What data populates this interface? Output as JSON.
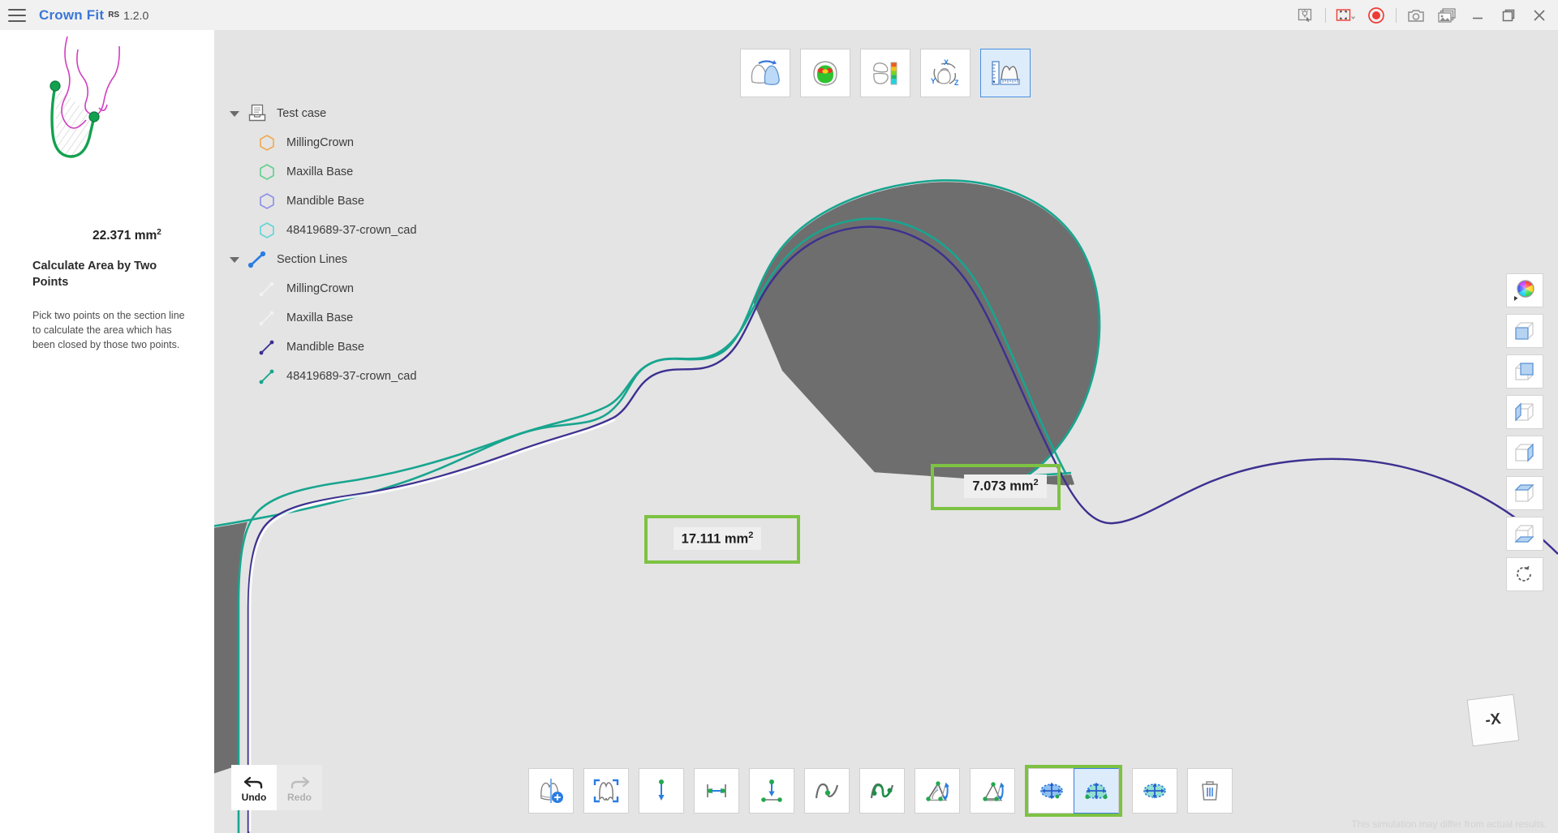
{
  "window": {
    "app_name": "Crown Fit",
    "app_mark": "RS",
    "version": "1.2.0",
    "menu_icon": "hamburger-menu-icon",
    "controls": [
      {
        "name": "annotation-pointer-icon",
        "label": "Annotate"
      },
      {
        "name": "region-capture-icon",
        "label": "Capture Region"
      },
      {
        "name": "record-icon",
        "label": "Record"
      },
      {
        "name": "camera-icon",
        "label": "Screenshot"
      },
      {
        "name": "gallery-icon",
        "label": "Gallery"
      },
      {
        "name": "minimize-icon",
        "label": "Minimize"
      },
      {
        "name": "maximize-icon",
        "label": "Maximize"
      },
      {
        "name": "close-icon",
        "label": "Close"
      }
    ]
  },
  "sidebar": {
    "preview_area_value": "22.371 mm",
    "preview_area_unit": "2",
    "heading": "Calculate Area by Two Points",
    "description": "Pick two points on the section line to calculate the area which has been closed by those two points."
  },
  "tree": {
    "groups": [
      {
        "label": "Test case",
        "icon": "case-tray-icon",
        "expanded": true,
        "items": [
          {
            "label": "MillingCrown",
            "icon": "hexagon-outline-icon",
            "color": "#f0a94e"
          },
          {
            "label": "Maxilla Base",
            "icon": "hexagon-outline-icon",
            "color": "#5fd08a"
          },
          {
            "label": "Mandible Base",
            "icon": "hexagon-outline-icon",
            "color": "#8d8ee8"
          },
          {
            "label": "48419689-37-crown_cad",
            "icon": "hexagon-outline-icon",
            "color": "#5fd6d6"
          }
        ]
      },
      {
        "label": "Section Lines",
        "icon": "section-line-icon",
        "expanded": true,
        "items": [
          {
            "label": "MillingCrown",
            "icon": "line-segment-icon",
            "color": "#ffffff"
          },
          {
            "label": "Maxilla Base",
            "icon": "line-segment-icon",
            "color": "#fafafa"
          },
          {
            "label": "Mandible Base",
            "icon": "line-segment-icon",
            "color": "#3c3090"
          },
          {
            "label": "48419689-37-crown_cad",
            "icon": "line-segment-icon",
            "color": "#18a58f"
          }
        ]
      }
    ]
  },
  "top_toolbar": {
    "buttons": [
      {
        "name": "crown-placement-icon",
        "label": "Crown Placement",
        "active": false
      },
      {
        "name": "contact-map-icon",
        "label": "Contact Map",
        "active": false
      },
      {
        "name": "thickness-colormap-icon",
        "label": "Thickness Color Map",
        "active": false
      },
      {
        "name": "orientation-axes-icon",
        "label": "Orientation",
        "active": false
      },
      {
        "name": "measure-ruler-icon",
        "label": "Measurement",
        "active": true
      }
    ]
  },
  "right_toolbar": {
    "buttons": [
      {
        "name": "color-wheel-icon",
        "label": "Color"
      },
      {
        "name": "view-front-icon",
        "label": "Front View"
      },
      {
        "name": "view-back-icon",
        "label": "Back View"
      },
      {
        "name": "view-left-icon",
        "label": "Left View"
      },
      {
        "name": "view-right-icon",
        "label": "Right View"
      },
      {
        "name": "view-top-icon",
        "label": "Top View"
      },
      {
        "name": "view-bottom-icon",
        "label": "Bottom View"
      },
      {
        "name": "reset-view-icon",
        "label": "Reset View"
      }
    ]
  },
  "bottom_toolbar": {
    "buttons": [
      {
        "name": "add-section-plane-icon",
        "label": "Add Section Plane",
        "state": "normal"
      },
      {
        "name": "fit-section-icon",
        "label": "Fit Section",
        "state": "normal"
      },
      {
        "name": "vertical-distance-icon",
        "label": "Vertical Distance",
        "state": "normal"
      },
      {
        "name": "horizontal-distance-icon",
        "label": "Horizontal Distance",
        "state": "normal"
      },
      {
        "name": "point-to-line-distance-icon",
        "label": "Point to Line Distance",
        "state": "normal"
      },
      {
        "name": "curve-point-icon",
        "label": "Point on Curve",
        "state": "normal"
      },
      {
        "name": "curve-segment-icon",
        "label": "Curve Segment",
        "state": "normal"
      },
      {
        "name": "angle-icon",
        "label": "Angle",
        "state": "normal"
      },
      {
        "name": "three-point-angle-icon",
        "label": "Three Point Angle",
        "state": "normal"
      },
      {
        "name": "area-closed-icon",
        "label": "Area of Closed Region",
        "state": "grouped"
      },
      {
        "name": "area-two-points-icon",
        "label": "Calculate Area by Two Points",
        "state": "selected"
      },
      {
        "name": "area-full-section-icon",
        "label": "Area of Full Section",
        "state": "normal"
      },
      {
        "name": "delete-icon",
        "label": "Delete Measurement",
        "state": "normal"
      }
    ]
  },
  "history": {
    "undo_label": "Undo",
    "undo_icon": "undo-arrow-icon",
    "undo_enabled": true,
    "redo_label": "Redo",
    "redo_icon": "redo-arrow-icon",
    "redo_enabled": false
  },
  "viewport": {
    "disclaimer": "This simulation may differ from actual results.",
    "axis_label": "-X",
    "measurements": [
      {
        "id": "m1",
        "value": "17.111 mm",
        "unit": "2"
      },
      {
        "id": "m2",
        "value": "7.073 mm",
        "unit": "2"
      }
    ],
    "colors": {
      "background": "#e4e4e4",
      "section_fill": "#6e6e6e",
      "crown_cad_outline": "#18a58f",
      "mandible_outline": "#3c3090",
      "highlight_green": "#7dc242",
      "accent_blue": "#3a77d8"
    }
  }
}
